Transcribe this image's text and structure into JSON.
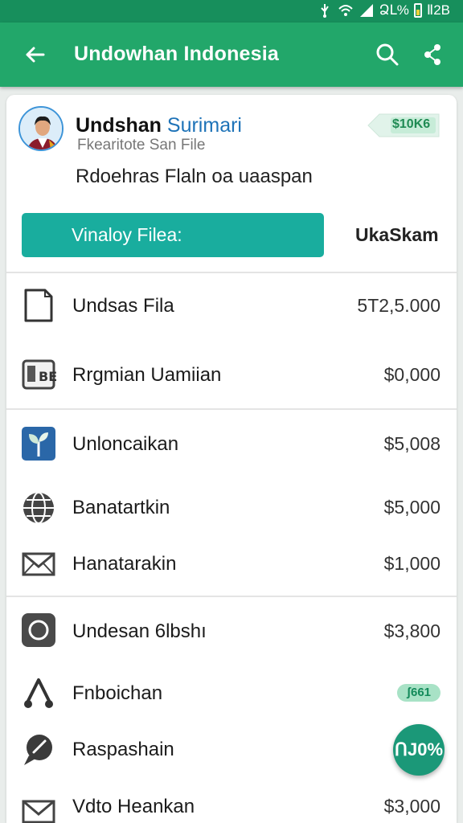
{
  "status_bar": {
    "time": "Ⅱ2B",
    "battery": "ՁԼ%"
  },
  "app_bar": {
    "title": "Undowhan Indonesia"
  },
  "profile": {
    "name_bold": "Undshan",
    "name_accent": "Surimari",
    "subtitle": "Fkearitote San File",
    "description": "Rdoehras Flaln oa uaaspan"
  },
  "tag_badge": "$10K6",
  "actions": {
    "primary": "Vinaloy Filea:",
    "secondary": "UkaSkam"
  },
  "rows": [
    {
      "label": "Undsas Fila",
      "value": "5T2,5.000",
      "icon": "document-icon"
    },
    {
      "label": "Rrgmian Uamiian",
      "value": "$0,000",
      "icon": "calendar-icon"
    },
    {
      "label": "Unloncaikan",
      "value": "$5,008",
      "icon": "plant-icon"
    },
    {
      "label": "Banatartkin",
      "value": "$5,000",
      "icon": "globe-icon"
    },
    {
      "label": "Hanatarakin",
      "value": "$1,000",
      "icon": "mail-icon"
    },
    {
      "label": "Undesan 6lbshı",
      "value": "$3,800",
      "icon": "circle-app-icon"
    },
    {
      "label": "Fnboichan",
      "value": "",
      "badge": "ʃ661",
      "icon": "music-note-icon"
    },
    {
      "label": "Raspashain",
      "value": "",
      "icon": "chat-icon"
    },
    {
      "label": "Vdto Heankan",
      "value": "$3,000",
      "icon": "envelope-icon"
    }
  ],
  "fab": {
    "label": "ՈJ0%"
  },
  "colors": {
    "status_bar": "#178f5c",
    "app_bar": "#22a76a",
    "primary_button": "#19ad9e",
    "fab": "#1b9878"
  }
}
